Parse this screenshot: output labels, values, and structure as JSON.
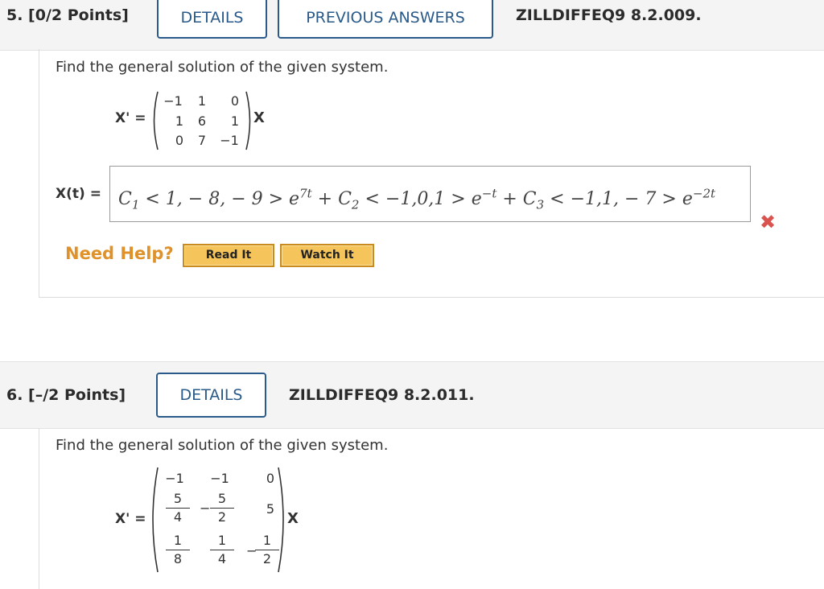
{
  "q5": {
    "points": "5. [0/2 Points]",
    "details_label": "DETAILS",
    "prev_answers_label": "PREVIOUS ANSWERS",
    "code": "ZILLDIFFEQ9 8.2.009.",
    "prompt": "Find the general solution of the given system.",
    "lhs": "X' =",
    "rhs_var": "X",
    "matrix": [
      [
        "−1",
        "1",
        "0"
      ],
      [
        "1",
        "6",
        "1"
      ],
      [
        "0",
        "7",
        "−1"
      ]
    ],
    "answer_label": "X(t) =",
    "answer_value": "C₁ < 1, − 8, − 9 > e^{7t} + C₂ < −1,0,1 > e^{−t} + C₃ < −1,1, − 7 > e^{−2t}",
    "answer_status": "incorrect",
    "need_help": "Need Help?",
    "read_it": "Read It",
    "watch_it": "Watch It"
  },
  "q6": {
    "points": "6. [–/2 Points]",
    "details_label": "DETAILS",
    "code": "ZILLDIFFEQ9 8.2.011.",
    "prompt": "Find the general solution of the given system.",
    "lhs": "X' =",
    "rhs_var": "X",
    "matrix": [
      [
        "−1",
        "−1",
        "0"
      ],
      [
        "5/4",
        "−5/2",
        "5"
      ],
      [
        "1/8",
        "1/4",
        "−1/2"
      ]
    ]
  },
  "colors": {
    "accent": "#2a5a8a",
    "help": "#e0922a",
    "error": "#d9534f",
    "button_fill": "#f5c45a"
  }
}
